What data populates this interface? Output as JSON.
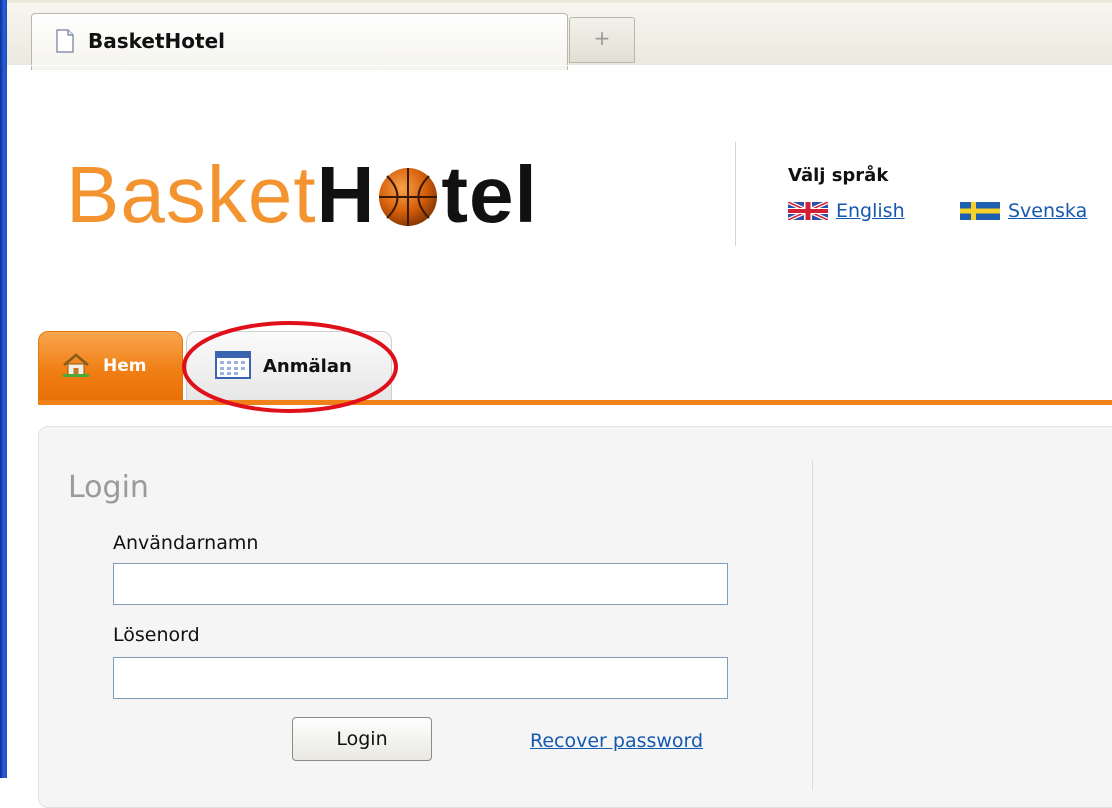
{
  "browser": {
    "tab_title": "BasketHotel",
    "new_tab_symbol": "+"
  },
  "logo": {
    "part1": "Basket",
    "part2_start": "H",
    "part2_end": "tel"
  },
  "language": {
    "title": "Välj språk",
    "english": "English",
    "swedish": "Svenska"
  },
  "nav": {
    "home": "Hem",
    "register": "Anmälan"
  },
  "login": {
    "title": "Login",
    "username_label": "Användarnamn",
    "username_value": "",
    "password_label": "Lösenord",
    "password_value": "",
    "button": "Login",
    "recover": "Recover password"
  },
  "colors": {
    "brand_orange": "#f08019",
    "link_blue": "#1558b0",
    "highlight_red": "#e0101a"
  },
  "icons": {
    "browser_tab": "page-icon",
    "home": "house-icon",
    "register": "calendar-icon",
    "english_flag": "uk-flag-icon",
    "swedish_flag": "sweden-flag-icon",
    "logo_o": "basketball-icon"
  }
}
